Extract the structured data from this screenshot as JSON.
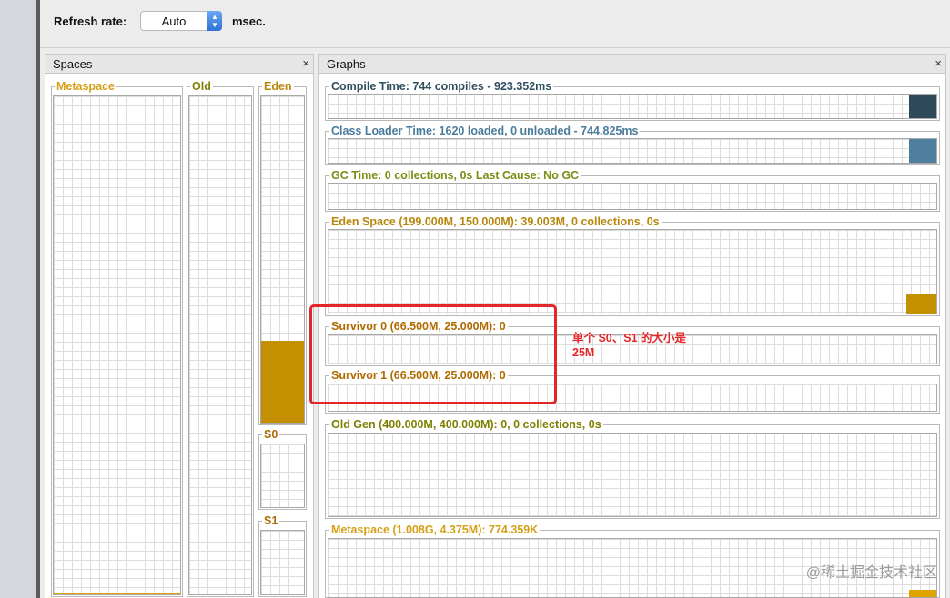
{
  "toolbar": {
    "refresh_label": "Refresh rate:",
    "refresh_value": "Auto",
    "refresh_unit": "msec."
  },
  "spaces": {
    "title": "Spaces",
    "close": "×",
    "boxes": {
      "metaspace": "Metaspace",
      "old": "Old",
      "eden": "Eden",
      "s0": "S0",
      "s1": "S1"
    }
  },
  "graphs": {
    "title": "Graphs",
    "close": "×",
    "items": [
      {
        "label": "Compile Time: 744 compiles - 923.352ms",
        "color": "#2f4f5f"
      },
      {
        "label": "Class Loader Time: 1620 loaded, 0 unloaded - 744.825ms",
        "color": "#4a7b9b"
      },
      {
        "label": "GC Time: 0 collections, 0s Last Cause: No GC",
        "color": "#7a8f15"
      },
      {
        "label": "Eden Space (199.000M, 150.000M): 39.003M, 0 collections, 0s",
        "color": "#b8860b"
      },
      {
        "label": "Survivor 0 (66.500M, 25.000M): 0",
        "color": "#b06a00"
      },
      {
        "label": "Survivor 1 (66.500M, 25.000M): 0",
        "color": "#b06a00"
      },
      {
        "label": "Old Gen (400.000M, 400.000M): 0, 0 collections, 0s",
        "color": "#808000"
      },
      {
        "label": "Metaspace (1.008G, 4.375M): 774.359K",
        "color": "#d4a017"
      }
    ]
  },
  "annotation": {
    "line1": "单个 S0、S1 的大小是",
    "line2": "25M"
  },
  "watermark": "@稀土掘金技术社区",
  "colors": {
    "eden_fill": "#c48f00",
    "compile_fill": "#2e4a5a",
    "classloader_fill": "#4f7f9e",
    "graph_eden_fill": "#c48f00",
    "metaspace_fill": "#e0a400",
    "annotation": "#e3262a"
  },
  "levels": {
    "eden_used_fraction": 0.25
  }
}
